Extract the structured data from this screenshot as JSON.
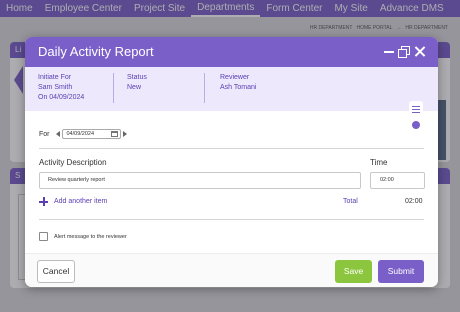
{
  "topnav": {
    "items": [
      "Home",
      "Employee Center",
      "Project Site",
      "Departments",
      "Form Center",
      "My Site",
      "Advance DMS"
    ],
    "active": "Departments"
  },
  "breadcrumb": [
    "HR DEPARTMENT",
    "HOME PORTAL",
    "→",
    "HR DEPARTMENT"
  ],
  "background": {
    "panel1_title_fragment": "Li",
    "panel2_title_fragment": "S"
  },
  "modal": {
    "title": "Daily Activity Report",
    "info": {
      "initiate_label": "Initiate For",
      "initiate_name": "Sam Smith",
      "initiate_date": "On 04/09/2024",
      "status_label": "Status",
      "status_value": "New",
      "reviewer_label": "Reviewer",
      "reviewer_value": "Ash Tomani"
    },
    "for_label": "For",
    "for_date": "04/09/2024",
    "activity_header": "Activity Description",
    "time_header": "Time",
    "rows": [
      {
        "description": "Review quarterly report",
        "time": "02:00"
      }
    ],
    "add_item_label": "Add another item",
    "total_label": "Total",
    "total_value": "02:00",
    "alert_label": "Alert message to the reviewer",
    "cancel_label": "Cancel",
    "save_label": "Save",
    "submit_label": "Submit"
  },
  "colors": {
    "brand": "#7b5fc9",
    "save": "#8cc63f",
    "info_bg": "#ede8fb"
  },
  "icons": [
    "minimize-icon",
    "restore-icon",
    "close-icon",
    "menu-icon",
    "dot-icon",
    "calendar-icon",
    "plus-icon",
    "arrow-left-icon",
    "arrow-right-icon"
  ]
}
